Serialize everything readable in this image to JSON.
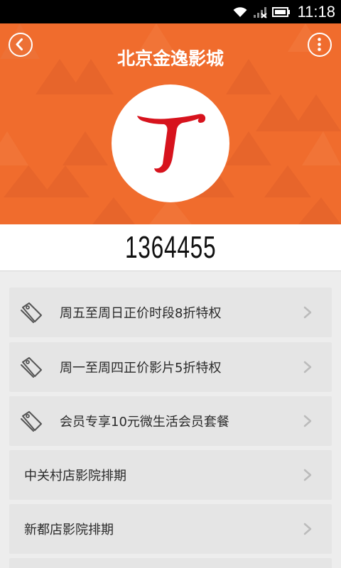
{
  "status_bar": {
    "time": "11:18",
    "icons": [
      "wifi-icon",
      "signal-icon",
      "battery-icon"
    ]
  },
  "header": {
    "title": "北京金逸影城",
    "back_icon": "back-arrow-icon",
    "more_icon": "more-vertical-icon",
    "logo": "cinema-logo"
  },
  "member": {
    "number": "1364455"
  },
  "privileges": [
    {
      "label": "周五至周日正价时段8折特权",
      "icon": "tag-icon"
    },
    {
      "label": "周一至周四正价影片5折特权",
      "icon": "tag-icon"
    },
    {
      "label": "会员专享10元微生活会员套餐",
      "icon": "tag-icon"
    }
  ],
  "schedules": [
    {
      "label": "中关村店影院排期"
    },
    {
      "label": "新都店影院排期"
    }
  ],
  "colors": {
    "accent": "#f06c2d",
    "logo_red": "#d7131d",
    "list_bg": "#e5e5e5",
    "page_bg": "#ededed"
  }
}
